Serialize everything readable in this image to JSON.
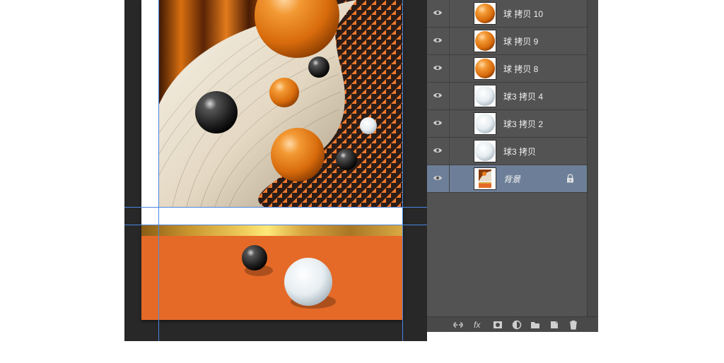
{
  "layers_panel": {
    "layers": [
      {
        "name": "球 拷贝 10",
        "thumb": "orange-ball",
        "visible": true,
        "selected": false,
        "locked": false
      },
      {
        "name": "球 拷贝 9",
        "thumb": "orange-ball",
        "visible": true,
        "selected": false,
        "locked": false
      },
      {
        "name": "球 拷贝 8",
        "thumb": "orange-ball",
        "visible": true,
        "selected": false,
        "locked": false
      },
      {
        "name": "球3 拷贝 4",
        "thumb": "white-ball",
        "visible": true,
        "selected": false,
        "locked": false
      },
      {
        "name": "球3 拷贝 2",
        "thumb": "white-ball",
        "visible": true,
        "selected": false,
        "locked": false
      },
      {
        "name": "球3 拷贝",
        "thumb": "white-ball",
        "visible": true,
        "selected": false,
        "locked": false
      },
      {
        "name": "背景",
        "thumb": "background",
        "visible": true,
        "selected": true,
        "locked": true
      }
    ],
    "footer_icons": [
      "link-layers-icon",
      "fx-icon",
      "layer-mask-icon",
      "adjustment-layer-icon",
      "new-group-icon",
      "new-layer-icon",
      "delete-layer-icon"
    ],
    "footer_fx_label": "fx"
  },
  "colors": {
    "panel_bg": "#535353",
    "selected_row": "#6d7f98",
    "canvas_bg": "#282828",
    "orange_panel": "#e56a27",
    "guide": "#4a86e0"
  }
}
